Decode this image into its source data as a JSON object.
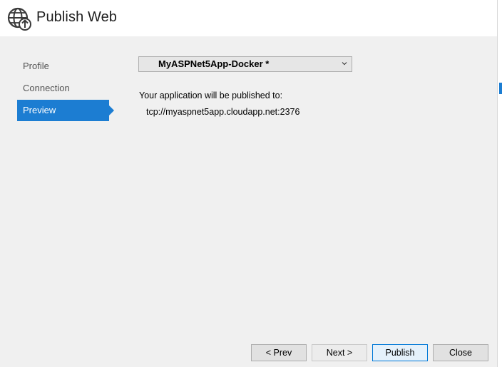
{
  "window": {
    "title": "Publish Web"
  },
  "nav": {
    "items": [
      {
        "label": "Profile",
        "active": false
      },
      {
        "label": "Connection",
        "active": false
      },
      {
        "label": "Preview",
        "active": true
      }
    ]
  },
  "profile_select": {
    "value": "MyASPNet5App-Docker *"
  },
  "preview": {
    "label": "Your application will be published to:",
    "target": "tcp://myaspnet5app.cloudapp.net:2376"
  },
  "buttons": {
    "prev": "< Prev",
    "next": "Next >",
    "publish": "Publish",
    "close": "Close"
  },
  "colors": {
    "accent": "#1c7dd2",
    "window_bg": "#f0f0f0"
  },
  "icons": {
    "title": "globe-upload-icon",
    "dropdown": "chevron-down-icon"
  }
}
